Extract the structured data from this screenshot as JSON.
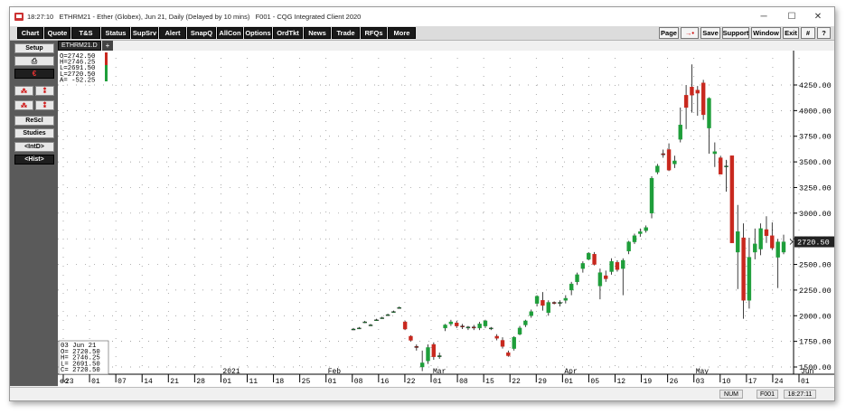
{
  "window": {
    "title": "18:27:10   ETHRM21 - Ether (Globex), Jun 21, Daily (Delayed by 10 mins)   F001 - CQG Integrated Client 2020",
    "controls": {
      "minimize": "─",
      "maximize": "☐",
      "close": "✕"
    }
  },
  "toolbar": {
    "left": [
      "Chart",
      "Quote",
      "T&S",
      "Status",
      "SupSrv",
      "Alert",
      "SnapQ",
      "AllCon",
      "Options",
      "OrdTkt",
      "News",
      "Trade",
      "RFQs",
      "More"
    ],
    "right": [
      "Page",
      "→•",
      "Save",
      "Support",
      "Window",
      "Exit",
      "#",
      "?"
    ]
  },
  "sidebar": {
    "setup": "Setup",
    "print_icon": "printer-icon",
    "euro_icon": "euro-icon",
    "rescl": "ReScl",
    "studies": "Studies",
    "intd": "<IntD>",
    "hist": "<Hist>"
  },
  "chart_tab": {
    "label": "ETHRM21.D",
    "add": "+"
  },
  "ohlc_top": [
    "O=2742.50",
    "H=2746.25",
    "L=2691.50",
    "L=2720.50",
    "A= -52.25"
  ],
  "ohlc_bottom": [
    "03 Jun 21",
    "O= 2720.50",
    "H= 2746.25",
    "L= 2691.50",
    "C= 2720.50"
  ],
  "colors": {
    "up": "#1e9e3a",
    "down": "#c8281e",
    "last_badge": "#222222"
  },
  "chart_data": {
    "type": "candlestick",
    "y_ticks": [
      "4250.00",
      "4000.00",
      "3750.00",
      "3500.00",
      "3250.00",
      "3000.00",
      "2750.00",
      "2500.00",
      "2250.00",
      "2000.00",
      "1750.00",
      "1500.00"
    ],
    "ylim": [
      1470,
      4450
    ],
    "last_price": "2720.50",
    "x_ticks": [
      "23",
      "01",
      "07",
      "14",
      "21",
      "28",
      "01",
      "11",
      "18",
      "25",
      "01",
      "08",
      "16",
      "22",
      "01",
      "08",
      "15",
      "22",
      "29",
      "01",
      "05",
      "12",
      "19",
      "26",
      "03",
      "10",
      "17",
      "24",
      "01"
    ],
    "month_labels": [
      "2021",
      "Feb",
      "Mar",
      "Apr",
      "May",
      "Jun"
    ],
    "edge_label": "ec",
    "candles": [
      [
        1870,
        1880,
        1860,
        1870
      ],
      [
        1880,
        1890,
        1870,
        1880
      ],
      [
        1940,
        1950,
        1930,
        1940
      ],
      [
        1910,
        1920,
        1900,
        1910
      ],
      [
        1960,
        1970,
        1950,
        1960
      ],
      [
        1980,
        1990,
        1970,
        1980
      ],
      [
        2010,
        2020,
        2000,
        2010
      ],
      [
        2040,
        2050,
        2030,
        2040
      ],
      [
        2080,
        2090,
        2070,
        2080
      ],
      [
        1940,
        1950,
        1860,
        1870
      ],
      [
        1800,
        1810,
        1750,
        1760
      ],
      [
        1700,
        1720,
        1660,
        1690
      ],
      [
        1500,
        1660,
        1460,
        1540
      ],
      [
        1560,
        1720,
        1530,
        1690
      ],
      [
        1720,
        1740,
        1570,
        1600
      ],
      [
        1600,
        1640,
        1580,
        1610
      ],
      [
        1880,
        1920,
        1850,
        1910
      ],
      [
        1920,
        1960,
        1900,
        1940
      ],
      [
        1930,
        1950,
        1880,
        1900
      ],
      [
        1900,
        1920,
        1870,
        1890
      ],
      [
        1880,
        1900,
        1860,
        1890
      ],
      [
        1890,
        1910,
        1860,
        1880
      ],
      [
        1880,
        1940,
        1860,
        1920
      ],
      [
        1900,
        1960,
        1880,
        1950
      ],
      [
        1880,
        1890,
        1860,
        1880
      ],
      [
        1800,
        1820,
        1760,
        1780
      ],
      [
        1760,
        1790,
        1680,
        1700
      ],
      [
        1640,
        1660,
        1600,
        1610
      ],
      [
        1680,
        1800,
        1660,
        1790
      ],
      [
        1820,
        1900,
        1810,
        1880
      ],
      [
        1910,
        1960,
        1890,
        1950
      ],
      [
        2000,
        2060,
        1980,
        2040
      ],
      [
        2120,
        2200,
        2090,
        2190
      ],
      [
        2150,
        2230,
        2050,
        2100
      ],
      [
        2030,
        2150,
        2000,
        2130
      ],
      [
        2130,
        2140,
        2110,
        2120
      ],
      [
        2120,
        2150,
        2090,
        2130
      ],
      [
        2150,
        2200,
        2120,
        2170
      ],
      [
        2250,
        2330,
        2200,
        2310
      ],
      [
        2330,
        2420,
        2300,
        2400
      ],
      [
        2460,
        2530,
        2420,
        2510
      ],
      [
        2550,
        2620,
        2540,
        2610
      ],
      [
        2600,
        2620,
        2490,
        2500
      ],
      [
        2290,
        2460,
        2160,
        2420
      ],
      [
        2390,
        2440,
        2330,
        2360
      ],
      [
        2430,
        2560,
        2400,
        2530
      ],
      [
        2520,
        2540,
        2430,
        2450
      ],
      [
        2460,
        2560,
        2200,
        2540
      ],
      [
        2630,
        2730,
        2600,
        2720
      ],
      [
        2720,
        2800,
        2700,
        2780
      ],
      [
        2800,
        2850,
        2770,
        2820
      ],
      [
        2830,
        2880,
        2810,
        2860
      ],
      [
        3000,
        3360,
        2950,
        3340
      ],
      [
        3400,
        3480,
        3380,
        3460
      ],
      [
        3580,
        3620,
        3540,
        3570
      ],
      [
        3620,
        3680,
        3410,
        3420
      ],
      [
        3480,
        3560,
        3440,
        3510
      ],
      [
        3720,
        4030,
        3690,
        3860
      ],
      [
        4150,
        4250,
        3820,
        4030
      ],
      [
        4230,
        4450,
        3980,
        4150
      ],
      [
        4200,
        4240,
        3950,
        4170
      ],
      [
        4270,
        4300,
        3910,
        3960
      ],
      [
        3830,
        4130,
        3580,
        4120
      ],
      [
        3580,
        3690,
        3450,
        3600
      ],
      [
        3540,
        3560,
        3380,
        3380
      ],
      [
        3460,
        3520,
        3210,
        3460
      ],
      [
        3560,
        3560,
        2900,
        2710
      ],
      [
        2620,
        3080,
        2260,
        2820
      ],
      [
        2760,
        2900,
        1970,
        2150
      ],
      [
        2150,
        2760,
        2070,
        2570
      ],
      [
        2620,
        2850,
        2550,
        2700
      ],
      [
        2650,
        2900,
        2590,
        2850
      ],
      [
        2840,
        2970,
        2710,
        2780
      ],
      [
        2780,
        2910,
        2640,
        2660
      ],
      [
        2570,
        2750,
        2270,
        2720
      ],
      [
        2620,
        2790,
        2600,
        2720
      ]
    ]
  },
  "status": {
    "num": "NUM",
    "page": "F001",
    "time": "18:27:11"
  }
}
